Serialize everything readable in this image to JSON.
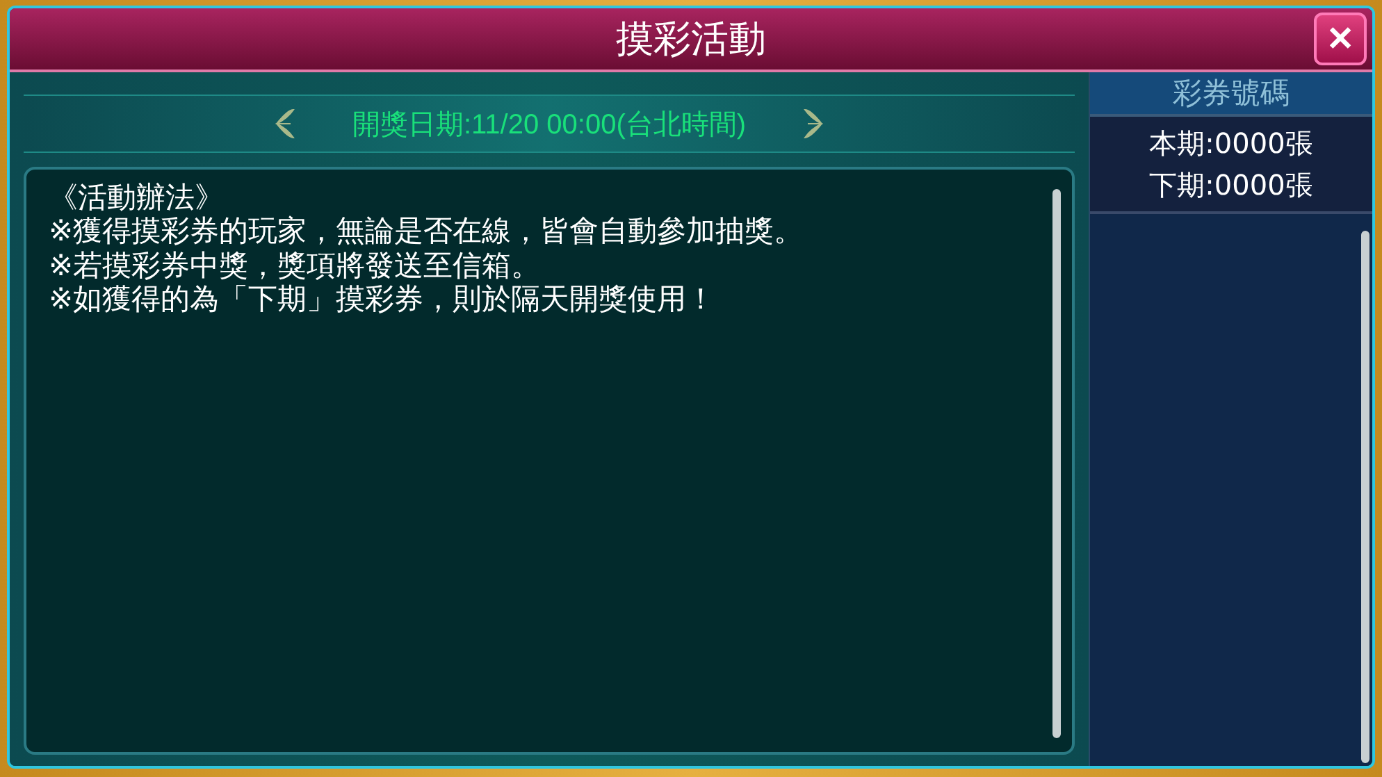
{
  "window": {
    "title": "摸彩活動",
    "close": "✕"
  },
  "draw_date": "開獎日期:11/20 00:00(台北時間)",
  "rules": {
    "heading": "《活動辦法》",
    "lines": [
      "※獲得摸彩券的玩家，無論是否在線，皆會自動參加抽獎。",
      "※若摸彩券中獎，獎項將發送至信箱。",
      "※如獲得的為「下期」摸彩券，則於隔天開獎使用！"
    ]
  },
  "tickets": {
    "title": "彩券號碼",
    "counts": [
      "本期:0000張",
      "下期:0000張"
    ]
  }
}
